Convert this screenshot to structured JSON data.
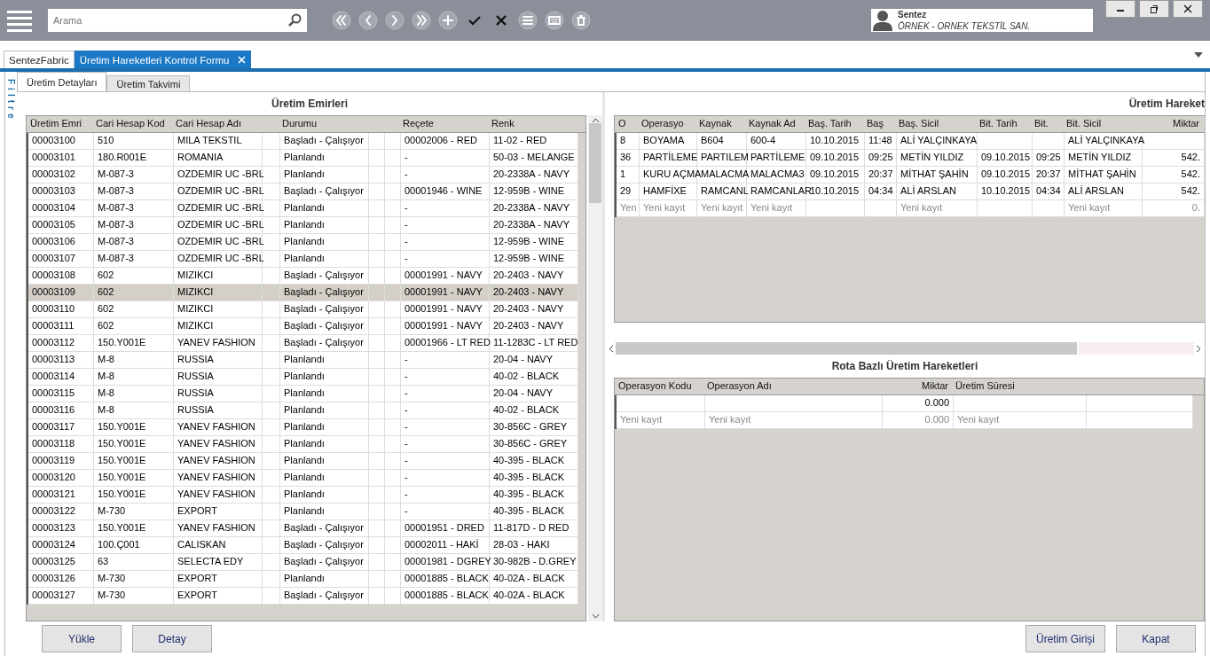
{
  "toolbar": {
    "search": {
      "placeholder": "Arama"
    }
  },
  "user": {
    "name": "Sentez",
    "company": "ÖRNEK - ORNEK TEKSTİL SAN."
  },
  "doc_tabs": [
    {
      "label": "SentezFabric",
      "selected": false,
      "closable": false
    },
    {
      "label": "Üretim Hareketleri Kontrol Formu",
      "selected": true,
      "closable": true
    }
  ],
  "side_label": "Filtre",
  "form_tabs": [
    {
      "label": "Üretim Detayları",
      "selected": true
    },
    {
      "label": "Üretim Takvimi",
      "selected": false
    }
  ],
  "orders": {
    "title": "Üretim Emirleri",
    "columns": [
      "Üretim Emri",
      "Cari Hesap Kod",
      "Cari Hesap Adı",
      "Durumu",
      "Reçete",
      "Renk"
    ],
    "rows": [
      {
        "selected": false,
        "cells": [
          "00003100",
          "510",
          "MILA TEKSTIL",
          "Başladı - Çalışıyor",
          "00002006 - RED",
          "11-02 - RED"
        ]
      },
      {
        "selected": false,
        "cells": [
          "00003101",
          "180.R001E",
          "ROMANIA",
          "Planlandı",
          "-",
          "50-03 - MELANGE"
        ]
      },
      {
        "selected": false,
        "cells": [
          "00003102",
          "M-087-3",
          "OZDEMIR UC -BRL",
          "Planlandı",
          "-",
          "20-2338A - NAVY"
        ]
      },
      {
        "selected": false,
        "cells": [
          "00003103",
          "M-087-3",
          "OZDEMIR UC -BRL",
          "Başladı - Çalışıyor",
          "00001946 - WINE",
          "12-959B - WINE"
        ]
      },
      {
        "selected": false,
        "cells": [
          "00003104",
          "M-087-3",
          "OZDEMIR UC -BRL",
          "Planlandı",
          "-",
          "20-2338A - NAVY"
        ]
      },
      {
        "selected": false,
        "cells": [
          "00003105",
          "M-087-3",
          "OZDEMIR UC -BRL",
          "Planlandı",
          "-",
          "20-2338A - NAVY"
        ]
      },
      {
        "selected": false,
        "cells": [
          "00003106",
          "M-087-3",
          "OZDEMIR UC -BRL",
          "Planlandı",
          "-",
          "12-959B - WINE"
        ]
      },
      {
        "selected": false,
        "cells": [
          "00003107",
          "M-087-3",
          "OZDEMIR UC -BRL",
          "Planlandı",
          "-",
          "12-959B - WINE"
        ]
      },
      {
        "selected": false,
        "cells": [
          "00003108",
          "602",
          "MIZIKCI",
          "Başladı - Çalışıyor",
          "00001991 - NAVY",
          "20-2403 - NAVY"
        ]
      },
      {
        "selected": true,
        "cells": [
          "00003109",
          "602",
          "MIZIKCI",
          "Başladı - Çalışıyor",
          "00001991 - NAVY",
          "20-2403 - NAVY"
        ]
      },
      {
        "selected": false,
        "cells": [
          "00003110",
          "602",
          "MIZIKCI",
          "Başladı - Çalışıyor",
          "00001991 - NAVY",
          "20-2403 - NAVY"
        ]
      },
      {
        "selected": false,
        "cells": [
          "00003111",
          "602",
          "MIZIKCI",
          "Başladı - Çalışıyor",
          "00001991 - NAVY",
          "20-2403 - NAVY"
        ]
      },
      {
        "selected": false,
        "cells": [
          "00003112",
          "150.Y001E",
          "YANEV FASHION",
          "Başladı - Çalışıyor",
          "00001966 - LT RED",
          "11-1283C - LT RED"
        ]
      },
      {
        "selected": false,
        "cells": [
          "00003113",
          "M-8",
          "RUSSIA",
          "Planlandı",
          "-",
          "20-04 - NAVY"
        ]
      },
      {
        "selected": false,
        "cells": [
          "00003114",
          "M-8",
          "RUSSIA",
          "Planlandı",
          "-",
          "40-02 - BLACK"
        ]
      },
      {
        "selected": false,
        "cells": [
          "00003115",
          "M-8",
          "RUSSIA",
          "Planlandı",
          "-",
          "20-04 - NAVY"
        ]
      },
      {
        "selected": false,
        "cells": [
          "00003116",
          "M-8",
          "RUSSIA",
          "Planlandı",
          "-",
          "40-02 - BLACK"
        ]
      },
      {
        "selected": false,
        "cells": [
          "00003117",
          "150.Y001E",
          "YANEV FASHION",
          "Planlandı",
          "-",
          "30-856C - GREY"
        ]
      },
      {
        "selected": false,
        "cells": [
          "00003118",
          "150.Y001E",
          "YANEV FASHION",
          "Planlandı",
          "-",
          "30-856C - GREY"
        ]
      },
      {
        "selected": false,
        "cells": [
          "00003119",
          "150.Y001E",
          "YANEV FASHION",
          "Planlandı",
          "-",
          "40-395 - BLACK"
        ]
      },
      {
        "selected": false,
        "cells": [
          "00003120",
          "150.Y001E",
          "YANEV FASHION",
          "Planlandı",
          "-",
          "40-395 - BLACK"
        ]
      },
      {
        "selected": false,
        "cells": [
          "00003121",
          "150.Y001E",
          "YANEV FASHION",
          "Planlandı",
          "-",
          "40-395 - BLACK"
        ]
      },
      {
        "selected": false,
        "cells": [
          "00003122",
          "M-730",
          "EXPORT",
          "Planlandı",
          "-",
          "40-395 - BLACK"
        ]
      },
      {
        "selected": false,
        "cells": [
          "00003123",
          "150.Y001E",
          "YANEV FASHION",
          "Başladı - Çalışıyor",
          "00001951 - DRED",
          "11-817D - D RED"
        ]
      },
      {
        "selected": false,
        "cells": [
          "00003124",
          "100.Ç001",
          "CALISKAN",
          "Başladı - Çalışıyor",
          "00002011 - HAKİ",
          "28-03 - HAKI"
        ]
      },
      {
        "selected": false,
        "cells": [
          "00003125",
          "63",
          "SELECTA EDY",
          "Başladı - Çalışıyor",
          "00001981 - DGREY",
          "30-982B - D.GREY"
        ]
      },
      {
        "selected": false,
        "cells": [
          "00003126",
          "M-730",
          "EXPORT",
          "Planlandı",
          "00001885 - BLACK",
          "40-02A - BLACK"
        ]
      },
      {
        "selected": false,
        "cells": [
          "00003127",
          "M-730",
          "EXPORT",
          "Başladı - Çalışıyor",
          "00001885 - BLACK",
          "40-02A - BLACK"
        ]
      }
    ]
  },
  "movements": {
    "title": "Üretim Hareket",
    "columns": [
      "O",
      "Operasyo",
      "Kaynak",
      "Kaynak Ad",
      "Baş. Tarih",
      "Baş",
      "Baş. Sicil",
      "Bit. Tarih",
      "Bit.",
      "Bit. Sicil",
      "Miktar"
    ],
    "rows": [
      {
        "kind": "data",
        "cells": [
          "8",
          "BOYAMA",
          "B604",
          "600-4",
          "10.10.2015",
          "11:48",
          "ALİ YALÇINKAYA",
          null,
          null,
          "ALİ YALÇINKAYA",
          null
        ]
      },
      {
        "kind": "data",
        "cells": [
          "36",
          "PARTİLEME",
          "PARTILEM",
          "PARTİLEME",
          "09.10.2015",
          "09:25",
          "METİN YILDIZ",
          "09.10.2015",
          "09:25",
          "METİN YILDIZ",
          "542."
        ]
      },
      {
        "kind": "data",
        "cells": [
          "1",
          "KURU AÇMA",
          "MALACMA",
          "MALACMA3",
          "09.10.2015",
          "20:37",
          "MİTHAT ŞAHİN",
          "09.10.2015",
          "20:37",
          "MİTHAT ŞAHİN",
          "542."
        ]
      },
      {
        "kind": "data",
        "cells": [
          "29",
          "HAMFİXE",
          "RAMCANL",
          "RAMCANLAR",
          "10.10.2015",
          "04:34",
          "ALİ ARSLAN",
          "10.10.2015",
          "04:34",
          "ALİ ARSLAN",
          "542."
        ]
      },
      {
        "kind": "new",
        "cells": [
          "Yen",
          "Yeni kayıt",
          "Yeni kayıt",
          "Yeni kayıt",
          null,
          null,
          "Yeni kayıt",
          null,
          null,
          "Yeni kayıt",
          "0."
        ]
      }
    ]
  },
  "route": {
    "title": "Rota Bazlı Üretim Hareketleri",
    "columns": [
      "Operasyon Kodu",
      "Operasyon Adı",
      "Miktar",
      "Üretim Süresi"
    ],
    "rows": [
      {
        "kind": "data",
        "cells": [
          null,
          null,
          "0.000",
          null
        ]
      },
      {
        "kind": "new",
        "cells": [
          "Yeni kayıt",
          "Yeni kayıt",
          "0.000",
          "Yeni kayıt"
        ]
      }
    ]
  },
  "buttons_left": [
    "Yükle",
    "Detay"
  ],
  "buttons_right": [
    "Üretim Girişi",
    "Kapat"
  ]
}
